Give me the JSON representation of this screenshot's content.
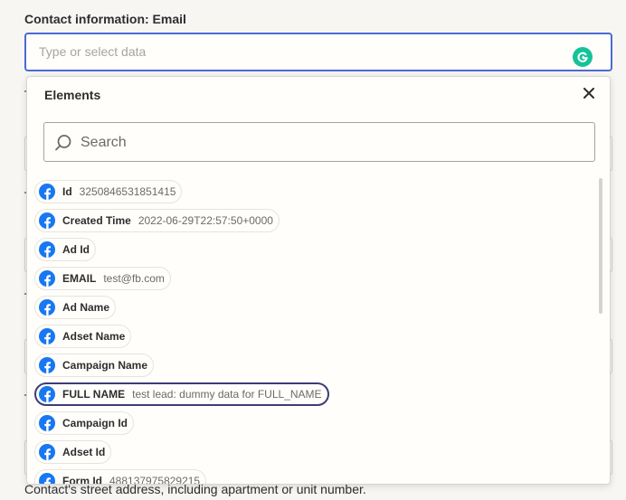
{
  "field": {
    "label": "Contact information: Email",
    "placeholder": "Type or select data"
  },
  "footer_hint": "Contact's street address, including apartment or unit number.",
  "popover": {
    "title": "Elements",
    "search_placeholder": "Search",
    "items": [
      {
        "label": "Id",
        "value": "3250846531851415",
        "selected": false
      },
      {
        "label": "Created Time",
        "value": "2022-06-29T22:57:50+0000",
        "selected": false
      },
      {
        "label": "Ad Id",
        "value": "",
        "selected": false
      },
      {
        "label": "EMAIL",
        "value": "test@fb.com",
        "selected": false
      },
      {
        "label": "Ad Name",
        "value": "",
        "selected": false
      },
      {
        "label": "Adset Name",
        "value": "",
        "selected": false
      },
      {
        "label": "Campaign Name",
        "value": "",
        "selected": false
      },
      {
        "label": "FULL NAME",
        "value": "test lead: dummy data for FULL_NAME",
        "selected": true
      },
      {
        "label": "Campaign Id",
        "value": "",
        "selected": false
      },
      {
        "label": "Adset Id",
        "value": "",
        "selected": false
      },
      {
        "label": "Form Id",
        "value": "488137975829215",
        "selected": false
      }
    ]
  },
  "colors": {
    "accent": "#4a6bd3",
    "facebook": "#1877f2",
    "grammarly": "#15c39a",
    "selected_border": "#3e3c77"
  },
  "icons": {
    "grammarly": "grammarly-icon",
    "close": "close-icon",
    "search": "search-icon",
    "item": "facebook-icon"
  }
}
